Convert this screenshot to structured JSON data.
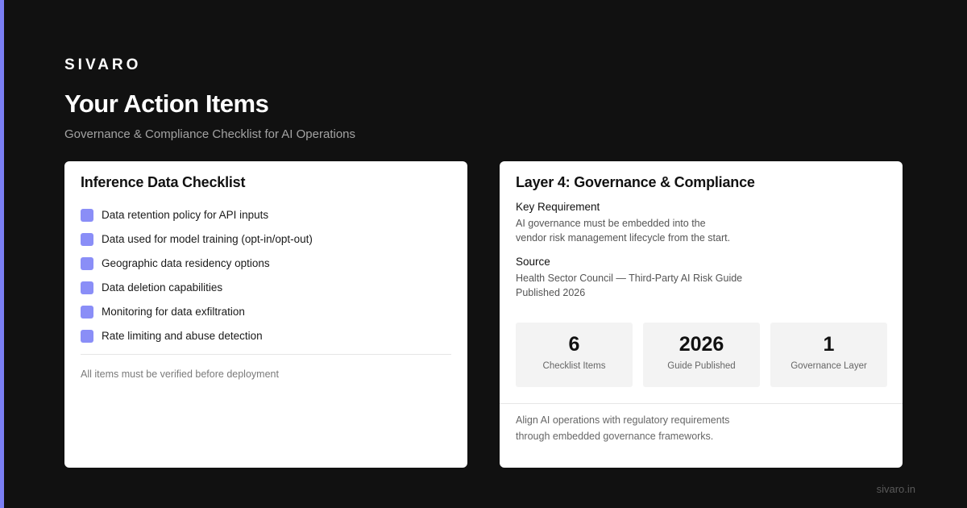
{
  "brand": "SIVARO",
  "page": {
    "title": "Your Action Items",
    "subtitle": "Governance & Compliance Checklist for AI Operations"
  },
  "left_card": {
    "title": "Inference Data Checklist",
    "items": [
      {
        "label": "Data retention policy for API inputs"
      },
      {
        "label": "Data used for model training (opt-in/opt-out)"
      },
      {
        "label": "Geographic data residency options"
      },
      {
        "label": "Data deletion capabilities"
      },
      {
        "label": "Monitoring for data exfiltration"
      },
      {
        "label": "Rate limiting and abuse detection"
      }
    ],
    "footnote": "All items must be verified before deployment"
  },
  "right_card": {
    "title": "Layer 4: Governance & Compliance",
    "key_requirement": {
      "label": "Key Requirement",
      "line1": "AI governance must be embedded into the",
      "line2": "vendor risk management lifecycle from the start."
    },
    "source": {
      "label": "Source",
      "line1": "Health Sector Council — Third-Party AI Risk Guide",
      "line2": "Published 2026"
    },
    "stats": [
      {
        "value": "6",
        "label": "Checklist Items"
      },
      {
        "value": "2026",
        "label": "Guide Published"
      },
      {
        "value": "1",
        "label": "Governance Layer"
      }
    ],
    "footnote_line1": "Align AI operations with regulatory requirements",
    "footnote_line2": "through embedded governance frameworks."
  },
  "footer": {
    "url": "sivaro.in"
  },
  "colors": {
    "accent": "#7b7ff5",
    "checkbox": "#8a8ef7",
    "background": "#111111"
  },
  "icons": {
    "checkbox": "checkbox-icon"
  }
}
